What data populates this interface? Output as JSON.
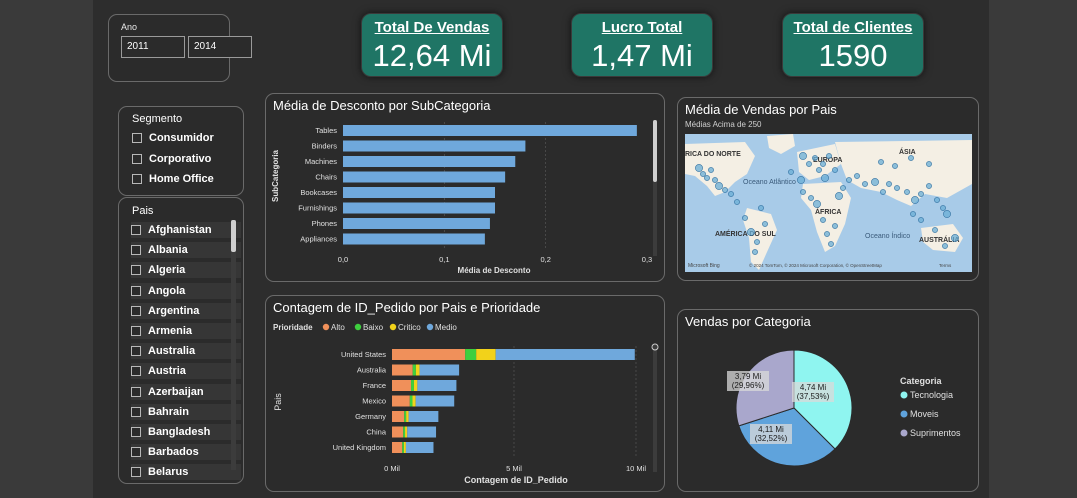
{
  "filters": {
    "year": {
      "label": "Ano",
      "from": "2011",
      "to": "2014"
    },
    "segment": {
      "title": "Segmento",
      "items": [
        "Consumidor",
        "Corporativo",
        "Home Office"
      ]
    },
    "country": {
      "title": "Pais",
      "items": [
        "Afghanistan",
        "Albania",
        "Algeria",
        "Angola",
        "Argentina",
        "Armenia",
        "Australia",
        "Austria",
        "Azerbaijan",
        "Bahrain",
        "Bangladesh",
        "Barbados",
        "Belarus"
      ]
    }
  },
  "kpis": [
    {
      "title": "Total De Vendas",
      "value": "12,64 Mi"
    },
    {
      "title": "Lucro Total",
      "value": "1,47 Mi"
    },
    {
      "title": "Total de Clientes",
      "value": "1590"
    }
  ],
  "discount_chart": {
    "title": "Média de Desconto por SubCategoria",
    "xlabel": "Média de Desconto",
    "ylabel": "SubCategoria",
    "ticks": [
      "0,0",
      "0,1",
      "0,2",
      "0,3"
    ],
    "color": "#6fa8dc"
  },
  "map": {
    "title": "Média de Vendas por Pais",
    "subtitle": "Médias Acima de 250",
    "labels": [
      "RICA DO NORTE",
      "EUROPA",
      "ÁSIA",
      "Oceano Atlântico",
      "ÁFRICA",
      "AMÉRICA DO SUL",
      "Oceano Índico",
      "AUSTRÁLIA"
    ],
    "brand": "Microsoft Bing",
    "attribution": "© 2024 TomTom, © 2024 Microsoft Corporation, © OpenStreetMap",
    "terms": "Terms"
  },
  "orders_chart": {
    "title": "Contagem de ID_Pedido por Pais e Prioridade",
    "legend_title": "Prioridade",
    "xlabel": "Contagem de ID_Pedido",
    "ylabel": "Pais",
    "ticks": [
      "0 Mil",
      "5 Mil",
      "10 Mil"
    ],
    "colors": {
      "Alto": "#f0905a",
      "Baixo": "#3ecf3e",
      "Critico": "#f2d21a",
      "Medio": "#6fa8dc"
    }
  },
  "pie": {
    "title": "Vendas por Categoria",
    "legend_title": "Categoria",
    "colors": {
      "Tecnologia": "#8ff5f0",
      "Moveis": "#5fa3dc",
      "Suprimentos": "#a9a7cc"
    }
  },
  "chart_data": [
    {
      "type": "bar",
      "title": "Média de Desconto por SubCategoria",
      "xlabel": "Média de Desconto",
      "ylabel": "SubCategoria",
      "categories": [
        "Tables",
        "Binders",
        "Machines",
        "Chairs",
        "Bookcases",
        "Furnishings",
        "Phones",
        "Appliances"
      ],
      "values": [
        0.29,
        0.18,
        0.17,
        0.16,
        0.15,
        0.15,
        0.145,
        0.14
      ],
      "xlim": [
        0,
        0.3
      ]
    },
    {
      "type": "bar",
      "title": "Contagem de ID_Pedido por Pais e Prioridade",
      "xlabel": "Contagem de ID_Pedido",
      "ylabel": "Pais",
      "categories": [
        "United States",
        "Australia",
        "France",
        "Mexico",
        "Germany",
        "China",
        "United Kingdom"
      ],
      "series": [
        {
          "name": "Alto",
          "values": [
            3000,
            850,
            780,
            730,
            500,
            460,
            420
          ]
        },
        {
          "name": "Baixo",
          "values": [
            450,
            130,
            120,
            110,
            80,
            75,
            70
          ]
        },
        {
          "name": "Critico",
          "values": [
            800,
            150,
            140,
            130,
            100,
            90,
            80
          ]
        },
        {
          "name": "Medio",
          "values": [
            5700,
            1620,
            1600,
            1580,
            1220,
            1180,
            1130
          ]
        }
      ],
      "xlim": [
        0,
        10000
      ]
    },
    {
      "type": "pie",
      "title": "Vendas por Categoria",
      "categories": [
        "Tecnologia",
        "Moveis",
        "Suprimentos"
      ],
      "values": [
        4.74,
        4.11,
        3.79
      ],
      "labels": [
        "4,74 Mi\n(37,53%)",
        "4,11 Mi\n(32,52%)",
        "3,79 Mi\n(29,96%)"
      ]
    }
  ]
}
